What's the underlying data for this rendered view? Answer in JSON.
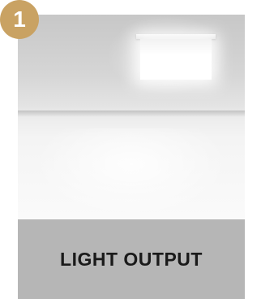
{
  "badge": {
    "number": "1",
    "color": "#c9a263"
  },
  "photo": {
    "description_icon": "ceiling-light-icon"
  },
  "caption": {
    "label": "LIGHT OUTPUT",
    "background": "#b6b6b6"
  }
}
